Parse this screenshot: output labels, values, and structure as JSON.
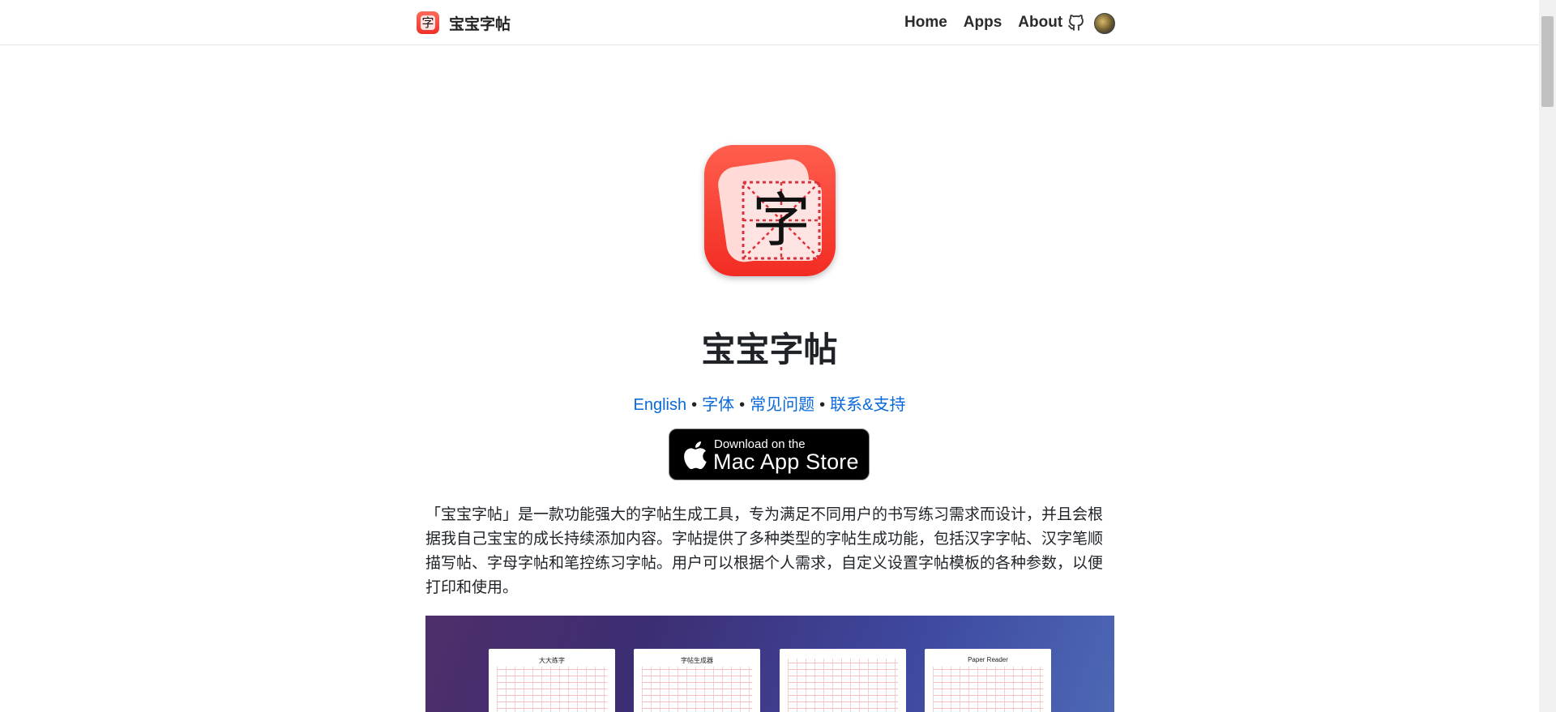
{
  "header": {
    "brand_logo_glyph": "字",
    "brand_name": "宝宝字帖",
    "nav": [
      "Home",
      "Apps",
      "About"
    ],
    "icons": [
      "github-icon",
      "avatar"
    ]
  },
  "main": {
    "app_icon_glyph": "字",
    "title": "宝宝字帖",
    "links": [
      "English",
      "字体",
      "常见问题",
      "联系&支持"
    ],
    "link_separator": "•",
    "store_badge": {
      "line1": "Download on the",
      "line2": "Mac App Store"
    },
    "description": "「宝宝字帖」是一款功能强大的字帖生成工具，专为满足不同用户的书写练习需求而设计，并且会根据我自己宝宝的成长持续添加内容。字帖提供了多种类型的字帖生成功能，包括汉字字帖、汉字笔顺描写帖、字母字帖和笔控练习字帖。用户可以根据个人需求，自定义设置字帖模板的各种参数，以便打印和使用。",
    "screenshot_sheets": [
      "大大练字",
      "字帖生成器",
      "",
      "Paper Reader"
    ]
  },
  "colors": {
    "link": "#0969da",
    "accent_red": "#f22c23",
    "text": "#1f2328"
  }
}
